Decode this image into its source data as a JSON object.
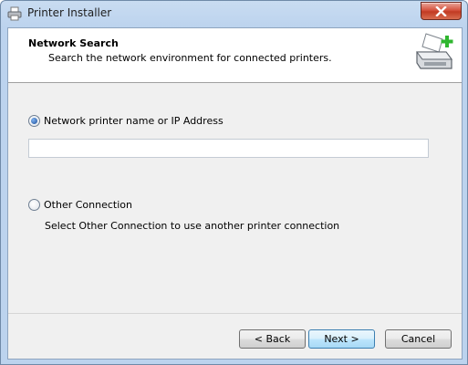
{
  "window": {
    "title": "Printer Installer"
  },
  "header": {
    "title": "Network Search",
    "subtitle": "Search the network environment for connected printers."
  },
  "options": {
    "network": {
      "label": "Network printer name or IP Address",
      "checked": true
    },
    "address_input": {
      "value": "",
      "placeholder": ""
    },
    "other": {
      "label": "Other Connection",
      "checked": false
    },
    "other_help": "Select Other Connection to use another printer connection"
  },
  "buttons": {
    "back": "< Back",
    "next": "Next >",
    "cancel": "Cancel"
  },
  "icons": {
    "app": "printer-icon",
    "header": "printer-add-icon",
    "close": "close-icon"
  },
  "colors": {
    "accent_green": "#2fb62f",
    "close_red": "#c13b23"
  }
}
